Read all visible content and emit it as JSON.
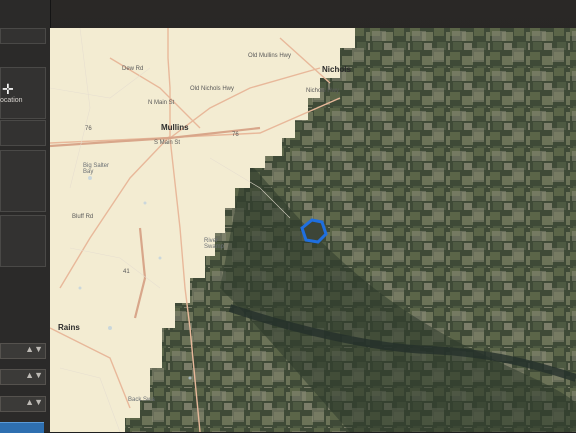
{
  "sidebar": {
    "location_label": "ocation",
    "icons": [
      "crosshair-icon"
    ]
  },
  "map": {
    "towns": [
      "Nichols",
      "Mullins",
      "Rains"
    ],
    "roads": [
      "Dew Rd",
      "Old Mullins Hwy",
      "Old Nichols Hwy",
      "Nichols Hwy",
      "N Main St",
      "S Main St",
      "Bluff Rd",
      "76",
      "76",
      "41"
    ],
    "features": [
      "Big Salter Bay",
      "River Swamp",
      "Back Swa"
    ],
    "highlight_color": "#1f6fe0"
  }
}
